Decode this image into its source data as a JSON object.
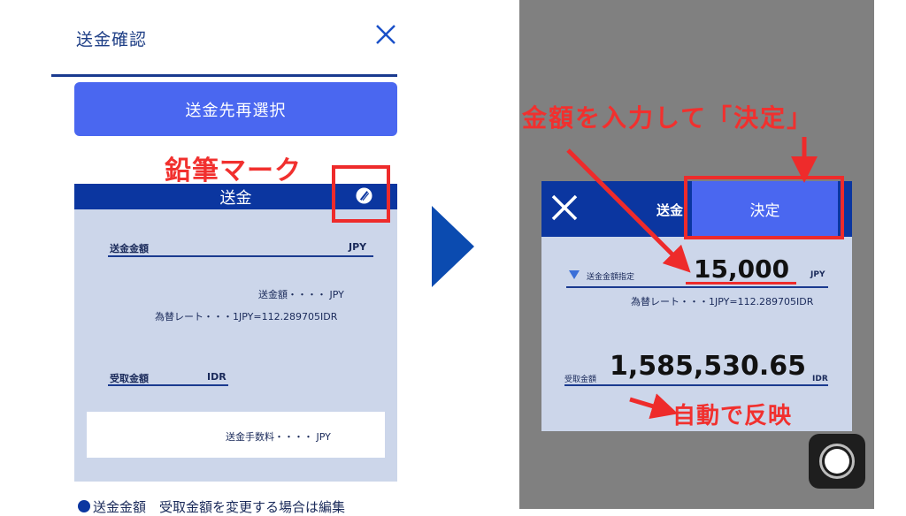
{
  "left_panel": {
    "title": "送金確認",
    "reselect_button": "送金先再選択",
    "pencil_annotation": "鉛筆マーク",
    "form": {
      "header": "送金",
      "send_amount_label": "送金金額",
      "send_currency": "JPY",
      "send_amount_line": "送金額・・・・ JPY",
      "rate_line": "為替レート・・・1JPY=112.289705IDR",
      "received_label": "受取金額",
      "received_currency": "IDR",
      "fee_line": "送金手数料・・・・ JPY"
    },
    "bottom_note": "送金金額　受取金額を変更する場合は編集"
  },
  "right_panel": {
    "annotation_top": "金額を入力して「決定」",
    "modal": {
      "title": "送金",
      "confirm_button": "決定",
      "amount_label": "送金金額指定",
      "amount_value": "15,000",
      "amount_currency": "JPY",
      "rate_line": "為替レート・・・1JPY=112.289705IDR",
      "received_label": "受取金額",
      "received_value": "1,585,530.65",
      "received_currency": "IDR"
    },
    "annotation_bottom": "自動で反映"
  },
  "colors": {
    "primary_blue": "#0b36a0",
    "button_blue": "#4a67f0",
    "annotation_red": "#f1302e",
    "card_bg": "#ccd6ea"
  },
  "icons": [
    "close-icon",
    "pencil-icon",
    "next-arrow-icon",
    "triangle-down-icon",
    "home-button-icon"
  ]
}
